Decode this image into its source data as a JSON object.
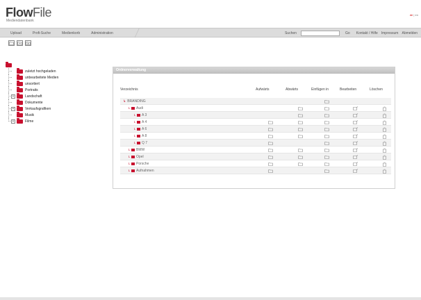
{
  "header": {
    "logo_bold": "Flow",
    "logo_thin": "File",
    "logo_sub": "Mediendatenbank",
    "lang_de": "de",
    "lang_sep": "|",
    "lang_en": "en"
  },
  "nav": {
    "tabs": [
      "Upload",
      "Profi-Suche",
      "Medienkorb",
      "Administration"
    ],
    "search_label": "Suchen",
    "search_value": "",
    "go_label": "Go",
    "links": [
      "Kontakt / Hilfe",
      "Impressum",
      "Abmelden"
    ]
  },
  "toolbar": {
    "icons": [
      "folder-add-icon",
      "folder-edit-icon",
      "folder-delete-icon"
    ]
  },
  "tree": {
    "items": [
      {
        "label": "zuletzt hochgeladen",
        "toggle": ""
      },
      {
        "label": "unbearbeitete Medien",
        "toggle": ""
      },
      {
        "label": "unsortiert",
        "toggle": ""
      },
      {
        "label": "Portraits",
        "toggle": ""
      },
      {
        "label": "Landschaft",
        "toggle": "+"
      },
      {
        "label": "Dokumente",
        "toggle": ""
      },
      {
        "label": "Verkaufsgrafiken",
        "toggle": "+"
      },
      {
        "label": "Musik",
        "toggle": ""
      },
      {
        "label": "Filme",
        "toggle": "+"
      }
    ]
  },
  "panel": {
    "title": "Ordnerverwaltung",
    "columns": {
      "dir": "Verzeichnis",
      "up": "Aufwärts",
      "down": "Abwärts",
      "insert": "Einfügen in",
      "edit": "Bearbeiten",
      "delete": "Löschen"
    },
    "rows": [
      {
        "name": "BRANDING",
        "level": 0,
        "up": false,
        "down": false,
        "insert": true,
        "edit": false,
        "delete": false
      },
      {
        "name": "Audi",
        "level": 1,
        "up": false,
        "down": true,
        "insert": true,
        "edit": true,
        "delete": true
      },
      {
        "name": "A 3",
        "level": 2,
        "up": false,
        "down": true,
        "insert": true,
        "edit": true,
        "delete": true
      },
      {
        "name": "A 4",
        "level": 2,
        "up": true,
        "down": true,
        "insert": true,
        "edit": true,
        "delete": true
      },
      {
        "name": "A 6",
        "level": 2,
        "up": true,
        "down": true,
        "insert": true,
        "edit": true,
        "delete": true
      },
      {
        "name": "A 8",
        "level": 2,
        "up": true,
        "down": true,
        "insert": true,
        "edit": true,
        "delete": true
      },
      {
        "name": "Q 7",
        "level": 2,
        "up": true,
        "down": false,
        "insert": true,
        "edit": true,
        "delete": true
      },
      {
        "name": "BMW",
        "level": 1,
        "up": true,
        "down": true,
        "insert": true,
        "edit": true,
        "delete": true
      },
      {
        "name": "Opel",
        "level": 1,
        "up": true,
        "down": true,
        "insert": true,
        "edit": true,
        "delete": true
      },
      {
        "name": "Porsche",
        "level": 1,
        "up": true,
        "down": true,
        "insert": true,
        "edit": true,
        "delete": true
      },
      {
        "name": "Aufnahmen",
        "level": 1,
        "up": true,
        "down": false,
        "insert": true,
        "edit": true,
        "delete": true
      }
    ]
  }
}
